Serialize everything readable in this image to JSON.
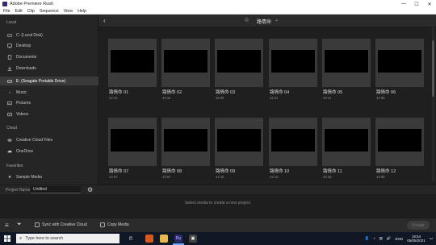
{
  "window": {
    "title": "Adobe Premiere Rush",
    "controls": [
      "minimize-icon",
      "maximize-icon",
      "close-icon"
    ]
  },
  "menu": [
    "File",
    "Edit",
    "Clip",
    "Sequence",
    "View",
    "Help"
  ],
  "sidebar": {
    "local_label": "Local",
    "local_items": [
      {
        "label": "C: (Local Disk)",
        "icon": "drive-icon"
      },
      {
        "label": "Desktop",
        "icon": "desktop-icon"
      },
      {
        "label": "Documents",
        "icon": "document-icon"
      },
      {
        "label": "Downloads",
        "icon": "download-icon"
      },
      {
        "label": "E: (Seagate Portable Drive)",
        "icon": "drive-icon",
        "active": true
      },
      {
        "label": "Music",
        "icon": "music-icon"
      },
      {
        "label": "Pictures",
        "icon": "picture-icon"
      },
      {
        "label": "Videos",
        "icon": "video-icon"
      }
    ],
    "cloud_label": "Cloud",
    "cloud_items": [
      {
        "label": "Creative Cloud Files",
        "icon": "creative-cloud-icon"
      },
      {
        "label": "OneDrive",
        "icon": "cloud-icon"
      }
    ],
    "favorites_label": "Favorites",
    "favorites_items": [
      {
        "label": "Sample Media",
        "icon": "star-icon"
      }
    ]
  },
  "header": {
    "folder": "路情命"
  },
  "clips": [
    {
      "name": "路情命 01",
      "duration": "42:12"
    },
    {
      "name": "路情命 02",
      "duration": "44:12"
    },
    {
      "name": "路情命 03",
      "duration": "46:39"
    },
    {
      "name": "路情命 04",
      "duration": "42:21"
    },
    {
      "name": "路情命 05",
      "duration": "43:11"
    },
    {
      "name": "路情命 06",
      "duration": "44:08"
    },
    {
      "name": "路情命 07",
      "duration": "44:57"
    },
    {
      "name": "路情命 08",
      "duration": "43:57"
    },
    {
      "name": "路情命 09",
      "duration": "44:15"
    },
    {
      "name": "路情命 10",
      "duration": "44:13"
    },
    {
      "name": "路情命 11",
      "duration": "43:48"
    },
    {
      "name": "路情命 12",
      "duration": "44:08"
    }
  ],
  "project": {
    "label": "Project Name",
    "value": "Untitled"
  },
  "message": "Select media to create a new project.",
  "bottombar": {
    "sync_label": "Sync with Creative Cloud",
    "copy_label": "Copy Media",
    "create_label": "Create"
  },
  "taskbar": {
    "search_placeholder": "Type here to search",
    "language": "ENG",
    "time": "18:54",
    "date": "05/05/2021"
  },
  "colors": {
    "accent": "#6fa8ff",
    "panel": "#252525",
    "thumbnail": "#3a3a3a"
  }
}
